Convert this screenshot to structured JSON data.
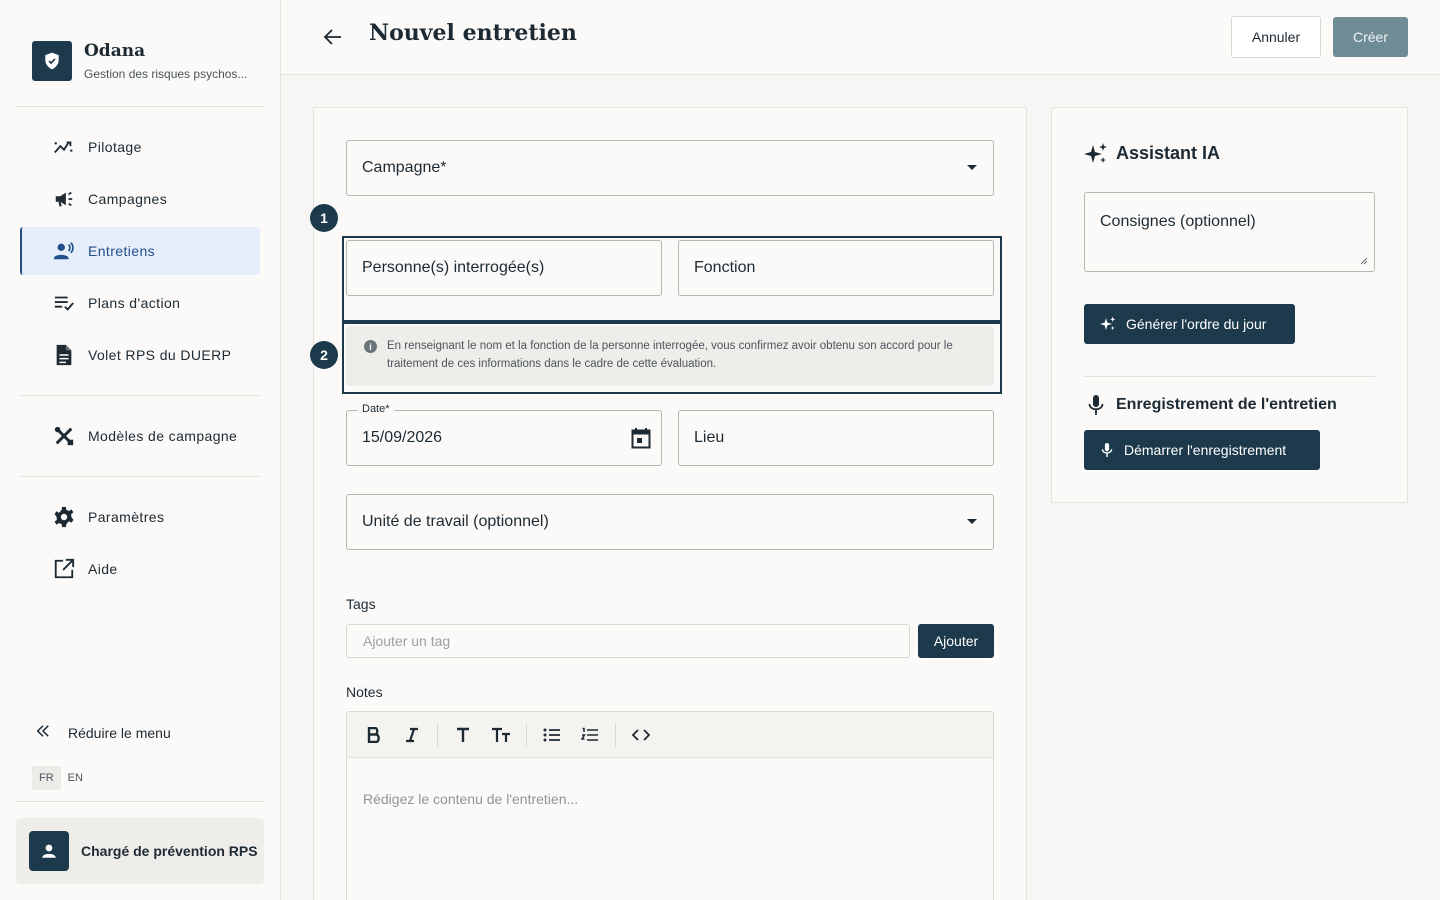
{
  "brand": {
    "name": "Odana",
    "subtitle": "Gestion des risques psychos..."
  },
  "sidebar": {
    "items": [
      {
        "label": "Pilotage",
        "icon": "chart-trend-icon"
      },
      {
        "label": "Campagnes",
        "icon": "megaphone-icon"
      },
      {
        "label": "Entretiens",
        "icon": "speaking-person-icon",
        "active": true
      },
      {
        "label": "Plans d'action",
        "icon": "checklist-icon"
      },
      {
        "label": "Volet RPS du DUERP",
        "icon": "document-icon"
      },
      {
        "label": "Modèles de campagne",
        "icon": "tools-icon"
      },
      {
        "label": "Paramètres",
        "icon": "gear-icon"
      },
      {
        "label": "Aide",
        "icon": "external-link-icon"
      }
    ],
    "collapse_label": "Réduire le menu",
    "languages": [
      "FR",
      "EN"
    ],
    "selected_language": "FR",
    "user_role": "Chargé de prévention RPS"
  },
  "header": {
    "title": "Nouvel entretien",
    "cancel_label": "Annuler",
    "create_label": "Créer"
  },
  "form": {
    "campaign_label": "Campagne*",
    "step_1": "1",
    "step_2": "2",
    "person_label": "Personne(s) interrogée(s)",
    "function_label": "Fonction",
    "consent_info": "En renseignant le nom et la fonction de la personne interrogée, vous confirmez avoir obtenu son accord pour le traitement de ces informations dans le cadre de cette évaluation.",
    "date_label": "Date*",
    "date_value": "15/09/2026",
    "place_label": "Lieu",
    "work_unit_label": "Unité de travail (optionnel)",
    "tags_label": "Tags",
    "tag_placeholder": "Ajouter un tag",
    "add_tag_label": "Ajouter",
    "notes_label": "Notes",
    "notes_placeholder": "Rédigez le contenu de l'entretien...",
    "toolbar": [
      "bold",
      "italic",
      "heading",
      "text-size",
      "bullet-list",
      "numbered-list",
      "code"
    ]
  },
  "assistant": {
    "title": "Assistant IA",
    "instructions_placeholder": "Consignes (optionnel)",
    "generate_label": "Générer l'ordre du jour",
    "recording_title": "Enregistrement de l'entretien",
    "start_recording_label": "Démarrer l'enregistrement"
  },
  "colors": {
    "primary": "#1c3a4b",
    "active_bg": "#e6eefb",
    "active_text": "#234f8a",
    "disabled_button": "#6f8c96"
  }
}
